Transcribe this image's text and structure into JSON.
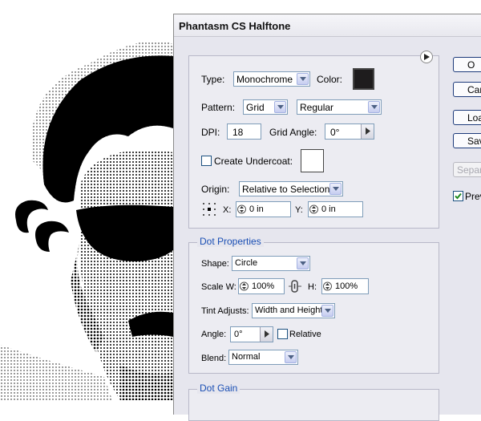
{
  "dialog": {
    "title": "Phantasm CS Halftone",
    "type_label": "Type:",
    "type_value": "Monochrome",
    "color_label": "Color:",
    "pattern_label": "Pattern:",
    "pattern_value": "Grid",
    "pattern_style_value": "Regular",
    "dpi_label": "DPI:",
    "dpi_value": "18",
    "grid_angle_label": "Grid Angle:",
    "grid_angle_value": "0°",
    "create_undercoat_label": "Create Undercoat:",
    "create_undercoat_checked": false,
    "origin_label": "Origin:",
    "origin_value": "Relative to Selection",
    "origin_x_label": "X:",
    "origin_x_value": "0 in",
    "origin_y_label": "Y:",
    "origin_y_value": "0 in",
    "dot_properties": {
      "legend": "Dot Properties",
      "shape_label": "Shape:",
      "shape_value": "Circle",
      "scale_w_label": "Scale W:",
      "scale_w_value": "100%",
      "scale_h_label": "H:",
      "scale_h_value": "100%",
      "tint_adjusts_label": "Tint Adjusts:",
      "tint_adjusts_value": "Width and Height",
      "angle_label": "Angle:",
      "angle_value": "0°",
      "relative_label": "Relative",
      "relative_checked": false,
      "blend_label": "Blend:",
      "blend_value": "Normal"
    },
    "dot_gain_legend": "Dot Gain",
    "buttons": {
      "ok_label": "O",
      "cancel_label": "Can",
      "load_label": "Loa",
      "save_label": "Sav",
      "separate_label": "Separ"
    },
    "preview_label": "Prev",
    "preview_checked": true
  },
  "colors": {
    "halftone_color": "#1e1c1d",
    "undercoat_color": "#ffffff",
    "legend_color": "#1a4fb4"
  },
  "icons": {
    "flyout": "triangle-right-icon",
    "origin": "origin-grid-icon",
    "spinner": "spinner-arrows-icon",
    "link": "chain-link-icon",
    "dropdown": "chevron-down-icon"
  }
}
